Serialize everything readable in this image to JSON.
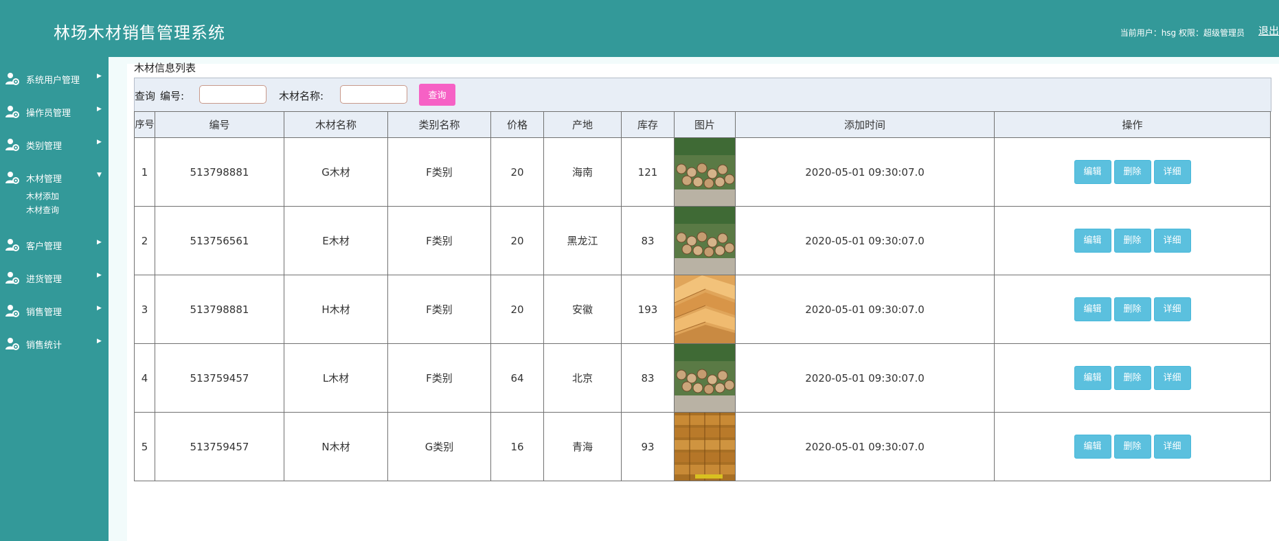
{
  "header": {
    "title": "林场木材销售管理系统",
    "user_info": "当前用户：hsg 权限：超级管理员",
    "logout": "退出"
  },
  "sidebar": {
    "items": [
      {
        "label": "系统用户管理",
        "arrow": "▶",
        "icon": "user-gear-icon"
      },
      {
        "label": "操作员管理",
        "arrow": "▶",
        "icon": "user-gear-icon"
      },
      {
        "label": "类别管理",
        "arrow": "▶",
        "icon": "user-gear-icon"
      },
      {
        "label": "木材管理",
        "arrow": "▼",
        "icon": "user-gear-icon"
      },
      {
        "label": "客户管理",
        "arrow": "▶",
        "icon": "user-gear-icon"
      },
      {
        "label": "进货管理",
        "arrow": "▶",
        "icon": "user-gear-icon"
      },
      {
        "label": "销售管理",
        "arrow": "▶",
        "icon": "user-gear-icon"
      },
      {
        "label": "销售统计",
        "arrow": "▶",
        "icon": "user-gear-icon"
      }
    ],
    "submenu": [
      "木材添加",
      "木材查询"
    ]
  },
  "main": {
    "section_title": "木材信息列表",
    "query": {
      "prefix": "查询",
      "code_label": "编号:",
      "code_value": "",
      "name_label": "木材名称:",
      "name_value": "",
      "button": "查询"
    },
    "table": {
      "columns": [
        "序号",
        "编号",
        "木材名称",
        "类别名称",
        "价格",
        "产地",
        "库存",
        "图片",
        "添加时间",
        "操作"
      ],
      "rows": [
        {
          "seq": "1",
          "code": "513798881",
          "name": "G木材",
          "category": "F类别",
          "price": "20",
          "origin": "海南",
          "stock": "121",
          "image": "log-pile",
          "time": "2020-05-01 09:30:07.0"
        },
        {
          "seq": "2",
          "code": "513756561",
          "name": "E木材",
          "category": "F类别",
          "price": "20",
          "origin": "黑龙江",
          "stock": "83",
          "image": "log-pile",
          "time": "2020-05-01 09:30:07.0"
        },
        {
          "seq": "3",
          "code": "513798881",
          "name": "H木材",
          "category": "F类别",
          "price": "20",
          "origin": "安徽",
          "stock": "193",
          "image": "planks",
          "time": "2020-05-01 09:30:07.0"
        },
        {
          "seq": "4",
          "code": "513759457",
          "name": "L木材",
          "category": "F类别",
          "price": "64",
          "origin": "北京",
          "stock": "83",
          "image": "log-pile",
          "time": "2020-05-01 09:30:07.0"
        },
        {
          "seq": "5",
          "code": "513759457",
          "name": "N木材",
          "category": "G类别",
          "price": "16",
          "origin": "青海",
          "stock": "93",
          "image": "lumber-stack",
          "time": "2020-05-01 09:30:07.0"
        }
      ],
      "actions": [
        "编辑",
        "删除",
        "详细"
      ]
    }
  },
  "colors": {
    "header_bg": "#339999",
    "sidebar_bg": "#339999",
    "query_button": "#f661c5",
    "action_button": "#5bc0de",
    "table_header_bg": "#e8eef6"
  }
}
